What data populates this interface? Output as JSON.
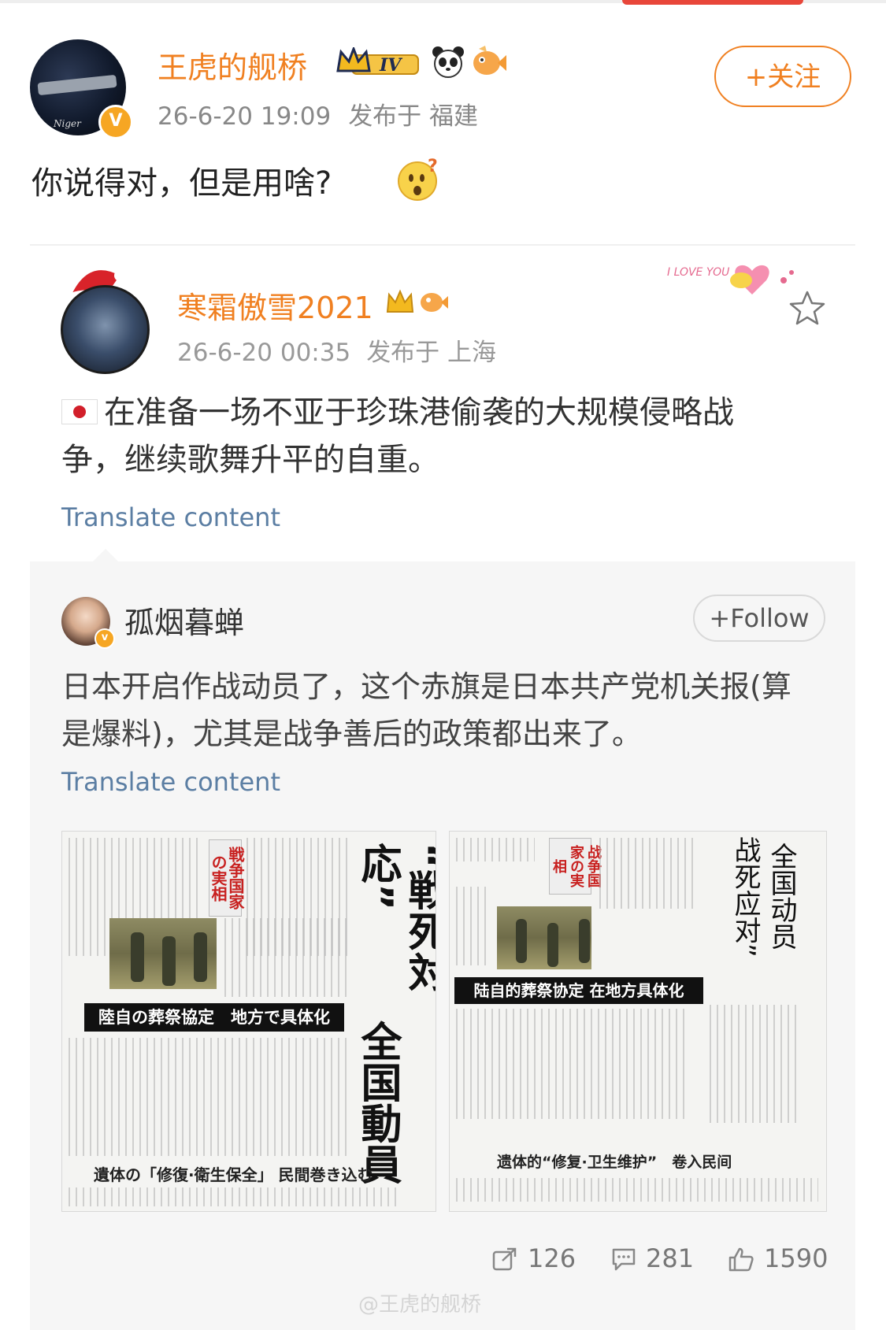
{
  "post": {
    "username": "王虎的舰桥",
    "level_badge": "IV",
    "avatar_signature": "Niger",
    "verified_mark": "V",
    "timestamp": "26-6-20 19:09",
    "location": "发布于 福建",
    "follow_label": "+关注",
    "text": "你说得对，但是用啥?",
    "emoji": "thinking-face"
  },
  "repost": {
    "username": "寒霜傲雪2021",
    "timestamp": "26-6-20 00:35",
    "location": "发布于 上海",
    "decoration_text": "I LOVE YOU",
    "text": "在准备一场不亚于珍珠港偷袭的大规模侵略战争，继续歌舞升平的自重。",
    "translate_label": "Translate content"
  },
  "quoted": {
    "username": "孤烟暮蝉",
    "follow_label": "+Follow",
    "text": "日本开启作战动员了，这个赤旗是日本共产党机关报(算是爆料)，尤其是战争善后的政策都出来了。",
    "translate_label": "Translate content",
    "images": [
      {
        "corner_label": "戦争国家の実相",
        "banner": "陸自の葬祭協定　地方で具体化",
        "vertical_title_1": "“戦死対応”",
        "vertical_title_2": "全国動員",
        "caption": "遺体の「修復·衛生保全」 民間巻き込む"
      },
      {
        "corner_label": "战争国家の実相",
        "banner": "陆自的葬祭协定 在地方具体化",
        "vertical_title_1": "战死应对”",
        "vertical_title_2": "全国动员",
        "caption": "遗体的“修复·卫生维护”　卷入民间"
      }
    ]
  },
  "stats": {
    "reposts": "126",
    "comments": "281",
    "likes": "1590"
  },
  "watermark": "@王虎的舰桥",
  "colors": {
    "username_orange": "#f08021",
    "translate_blue": "#5b7ea3",
    "card_bg": "#f6f6f6"
  }
}
